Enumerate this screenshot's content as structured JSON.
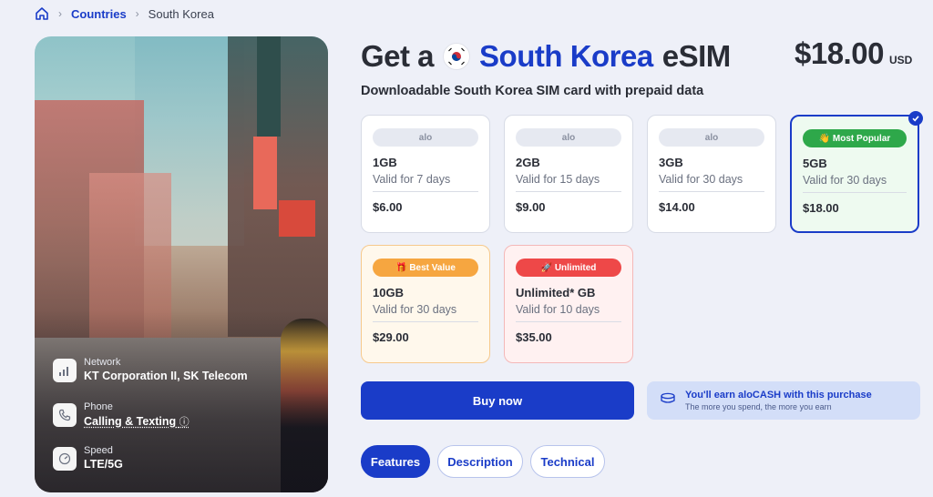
{
  "breadcrumb": {
    "home_icon": "home-icon",
    "countries": "Countries",
    "current": "South Korea"
  },
  "header": {
    "title_prefix": "Get a",
    "title_country": "South Korea",
    "title_suffix": "eSIM",
    "flag_icon": "south-korea-flag-icon",
    "price": "$18.00",
    "currency": "USD",
    "subtitle": "Downloadable South Korea SIM card with prepaid data"
  },
  "plans": [
    {
      "tag": "alo",
      "size": "1GB",
      "validity": "Valid for 7 days",
      "price": "$6.00",
      "selected": false
    },
    {
      "tag": "alo",
      "size": "2GB",
      "validity": "Valid for 15 days",
      "price": "$9.00",
      "selected": false
    },
    {
      "tag": "alo",
      "size": "3GB",
      "validity": "Valid for 30 days",
      "price": "$14.00",
      "selected": false
    },
    {
      "tag": "👋 Most Popular",
      "size": "5GB",
      "validity": "Valid for 30 days",
      "price": "$18.00",
      "selected": true
    },
    {
      "tag": "🎁 Best Value",
      "size": "10GB",
      "validity": "Valid for 30 days",
      "price": "$29.00",
      "selected": false
    },
    {
      "tag": "🚀 Unlimited",
      "size": "Unlimited* GB",
      "validity": "Valid for 10 days",
      "price": "$35.00",
      "selected": false
    }
  ],
  "specs": {
    "network_label": "Network",
    "network_value": "KT Corporation II, SK Telecom",
    "phone_label": "Phone",
    "phone_value": "Calling & Texting",
    "speed_label": "Speed",
    "speed_value": "LTE/5G"
  },
  "buy_label": "Buy now",
  "cash": {
    "line1": "You'll earn aloCASH with this purchase",
    "line2": "The more you spend, the more you earn"
  },
  "tabs": [
    "Features",
    "Description",
    "Technical"
  ],
  "colors": {
    "accent": "#1a3cc8",
    "popular": "#2ea84a",
    "best_value": "#f6a640",
    "unlimited": "#ee4848"
  }
}
